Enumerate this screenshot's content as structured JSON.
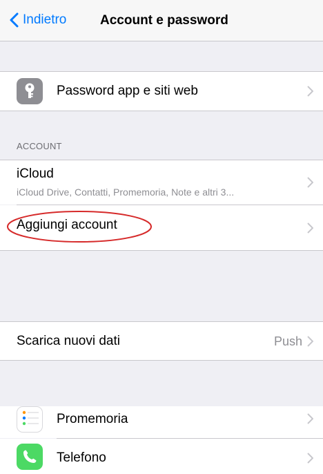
{
  "nav": {
    "back_label": "Indietro",
    "title": "Account e password"
  },
  "rows": {
    "passwords_label": "Password app e siti web",
    "section_header": "ACCOUNT",
    "icloud_title": "iCloud",
    "icloud_subtitle": "iCloud Drive, Contatti, Promemoria, Note e altri 3...",
    "add_account_label": "Aggiungi account",
    "fetch_label": "Scarica nuovi dati",
    "fetch_value": "Push",
    "reminders_label": "Promemoria",
    "phone_label": "Telefono"
  },
  "colors": {
    "accent": "#007aff",
    "annotation": "#d62a2a",
    "phone_icon": "#4cd964",
    "key_icon": "#8e8e93"
  },
  "icons": [
    "chevron-left-icon",
    "key-icon",
    "reminders-icon",
    "phone-icon",
    "chevron-right-icon"
  ]
}
